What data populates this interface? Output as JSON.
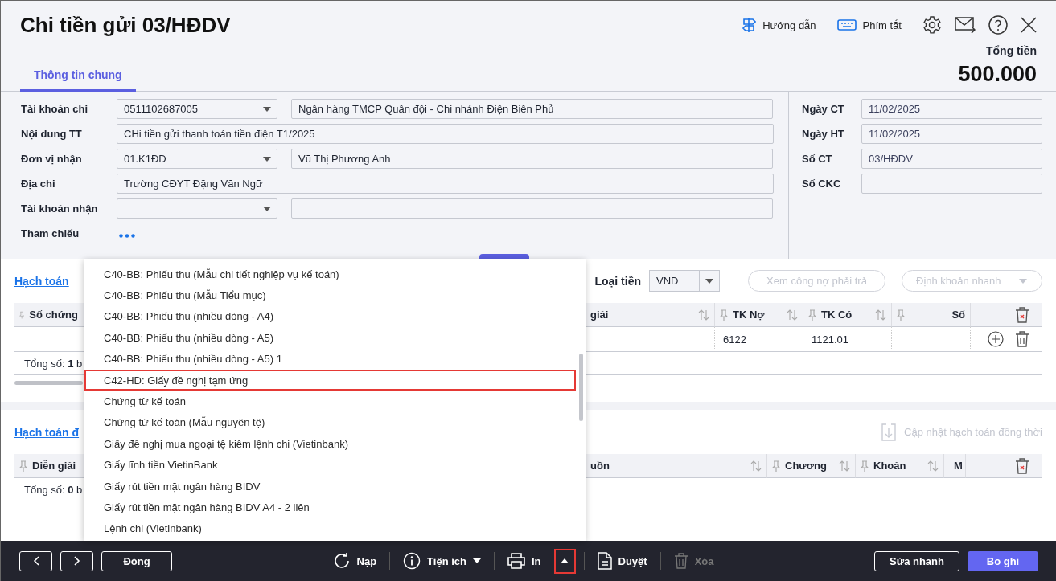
{
  "window": {
    "title": "Chi tiền gửi 03/HĐDV"
  },
  "header_actions": [
    {
      "kind": "guide",
      "label": "Hướng dẫn"
    },
    {
      "kind": "shortcuts",
      "label": "Phím tắt"
    },
    {
      "kind": "settings"
    },
    {
      "kind": "mail"
    },
    {
      "kind": "help"
    },
    {
      "kind": "close"
    }
  ],
  "total": {
    "label": "Tổng tiền",
    "value": "500.000"
  },
  "tabs": [
    {
      "label": "Thông tin chung",
      "selected": true
    }
  ],
  "form": {
    "left": [
      {
        "kind": "combo_text",
        "label": "Tài khoản chi",
        "value": "0511102687005",
        "text": "Ngân hàng TMCP Quân đội - Chi nhánh Điện Biên Phủ"
      },
      {
        "kind": "text",
        "label": "Nội dung TT",
        "value": "CHi tiền gửi thanh toán tiền điện T1/2025"
      },
      {
        "kind": "combo_text",
        "label": "Đơn vị nhận",
        "value": "01.K1ĐD",
        "text": "Vũ Thị Phương Anh"
      },
      {
        "kind": "text",
        "label": "Địa chi",
        "value": "Trường CĐYT Đặng Văn Ngữ"
      },
      {
        "kind": "combo_text",
        "label": "Tài khoản nhận"
      },
      {
        "kind": "more",
        "label": "Tham chiếu"
      }
    ],
    "right": [
      {
        "label": "Ngày CT",
        "value": "11/02/2025"
      },
      {
        "label": "Ngày HT",
        "value": "11/02/2025"
      },
      {
        "label": "Số CT",
        "value": "03/HĐDV"
      },
      {
        "label": "Số CKC"
      }
    ]
  },
  "posting": {
    "title": "Hạch toán",
    "currency_label": "Loại tiền",
    "currency": "VND",
    "buttons": [
      {
        "kind": "plain",
        "label": "Xem công nợ phải trả",
        "disabled": true
      },
      {
        "kind": "dropdown",
        "label": "Định khoản nhanh",
        "disabled": true
      }
    ],
    "columns": [
      {
        "kind": "data",
        "label": "Số chứng",
        "pin": true,
        "sort": false
      },
      {
        "kind": "data",
        "label": "giải",
        "pin": false,
        "sort": true
      },
      {
        "kind": "data",
        "label": "TK Nợ",
        "pin": true,
        "sort": true
      },
      {
        "kind": "data",
        "label": "TK Có",
        "pin": true,
        "sort": true
      },
      {
        "kind": "data",
        "label": "Số",
        "pin": true,
        "sort": false
      },
      {
        "kind": "delete"
      }
    ],
    "rows": [
      {
        "cells": [
          "",
          "",
          "6122",
          "1121.01",
          ""
        ]
      }
    ],
    "footer": "Tổng số: **1** b"
  },
  "simultaneous": {
    "title": "Hạch toán đ",
    "action": {
      "label": "Cập nhật hạch toán đồng thời",
      "disabled": true
    },
    "columns": [
      {
        "kind": "data",
        "label": "Diễn giải",
        "pin": true,
        "sort": false
      },
      {
        "kind": "data",
        "label": "uồn",
        "pin": false,
        "sort": true
      },
      {
        "kind": "data",
        "label": "Chương",
        "pin": true,
        "sort": true
      },
      {
        "kind": "data",
        "label": "Khoản",
        "pin": true,
        "sort": true
      },
      {
        "kind": "data",
        "label": "M",
        "pin": true,
        "sort": false
      },
      {
        "kind": "delete"
      }
    ],
    "footer": "Tổng số: **0** b"
  },
  "print_menu": {
    "items": [
      {
        "label": "C40-BB: Phiếu thu (Mẫu chi tiết nghiệp vụ kế toán)",
        "highlighted": false
      },
      {
        "label": "C40-BB: Phiếu thu (Mẫu Tiểu mục)",
        "highlighted": false
      },
      {
        "label": "C40-BB: Phiếu thu (nhiều dòng - A4)",
        "highlighted": false
      },
      {
        "label": "C40-BB: Phiếu thu (nhiều dòng - A5)",
        "highlighted": false
      },
      {
        "label": "C40-BB: Phiếu thu (nhiều dòng - A5) 1",
        "highlighted": false
      },
      {
        "label": "C42-HD: Giấy đề nghị tạm ứng",
        "highlighted": true
      },
      {
        "label": "Chứng từ kế toán",
        "highlighted": false
      },
      {
        "label": "Chứng từ kế toán (Mẫu nguyên tệ)",
        "highlighted": false
      },
      {
        "label": "Giấy đề nghị mua ngoại tệ kiêm lệnh chi (Vietinbank)",
        "highlighted": false
      },
      {
        "label": "Giấy lĩnh tiền VietinBank",
        "highlighted": false
      },
      {
        "label": "Giấy rút tiền mặt ngân hàng BIDV",
        "highlighted": false
      },
      {
        "label": "Giấy rút tiền mặt ngân hàng BIDV A4 - 2 liên",
        "highlighted": false
      },
      {
        "label": "Lệnh chi (Vietinbank)",
        "highlighted": false
      }
    ]
  },
  "toolbar": [
    {
      "kind": "prev"
    },
    {
      "kind": "next"
    },
    {
      "kind": "close",
      "label": "Đóng"
    },
    {
      "kind": "spacer"
    },
    {
      "kind": "reload",
      "label": "Nạp"
    },
    {
      "kind": "divider"
    },
    {
      "kind": "utilities",
      "label": "Tiện ích"
    },
    {
      "kind": "divider"
    },
    {
      "kind": "print",
      "label": "In"
    },
    {
      "kind": "print_menu",
      "highlighted": true
    },
    {
      "kind": "divider"
    },
    {
      "kind": "approve",
      "label": "Duyệt"
    },
    {
      "kind": "divider"
    },
    {
      "kind": "delete",
      "label": "Xóa",
      "disabled": true
    },
    {
      "kind": "spacer"
    },
    {
      "kind": "quick_edit",
      "label": "Sửa nhanh"
    },
    {
      "kind": "unpost",
      "label": "Bỏ ghi"
    }
  ]
}
